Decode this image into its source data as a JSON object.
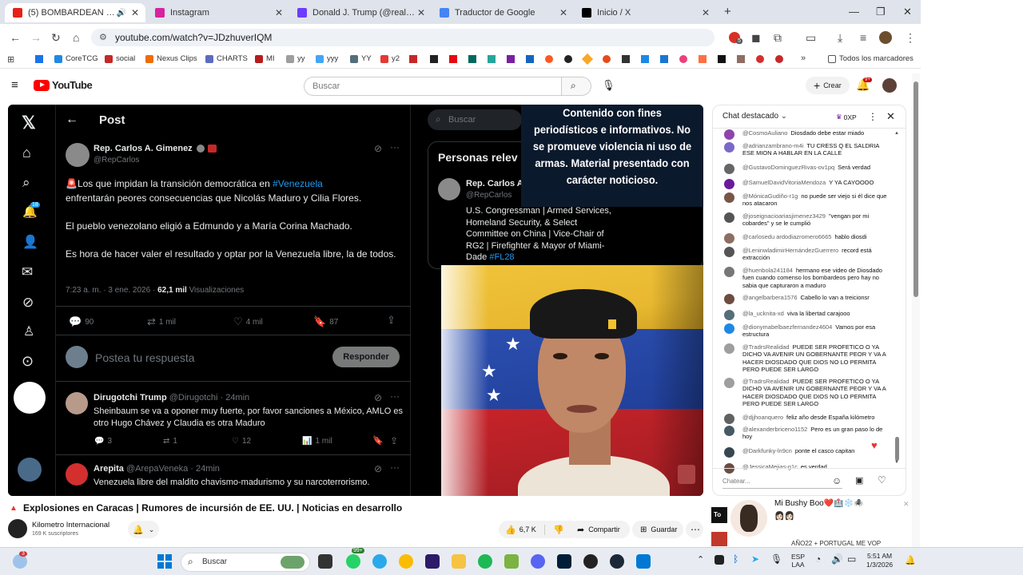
{
  "browser": {
    "tabs": [
      {
        "label": "(5) BOMBARDEAN CARACA",
        "color": "#e62117",
        "active": true
      },
      {
        "label": "Instagram",
        "color": "#d6249f",
        "active": false
      },
      {
        "label": "Donald J. Trump (@realDonald",
        "color": "#6e3bff",
        "active": false
      },
      {
        "label": "Traductor de Google",
        "color": "#4285f4",
        "active": false
      },
      {
        "label": "Inicio / X",
        "color": "#000000",
        "active": false
      }
    ],
    "url": "youtube.com/watch?v=JDzhuverIQM",
    "bookmarks": [
      "CoreTCG",
      "social",
      "Nexus Clips",
      "CHARTS",
      "MI",
      "yy",
      "yyy",
      "YY",
      "y2"
    ],
    "all_bookmarks": "Todos los marcadores",
    "notif_badge": "5"
  },
  "youtube": {
    "logo": "YouTube",
    "search_placeholder": "Buscar",
    "create": "Crear",
    "notif_count": "9+"
  },
  "video": {
    "x_header": "Post",
    "x_search": "Buscar",
    "x_notif_badge": "18",
    "author": "Rep. Carlos A. Gimenez",
    "handle": "@RepCarlos",
    "tweet_line1_pre": "🚨Los que impidan la transición democrática en ",
    "tweet_hashtag": "#Venezuela",
    "tweet_line2": "enfrentarán peores consecuencias que Nicolás Maduro y Cilia Flores.",
    "tweet_p2": "El pueblo venezolano eligió a Edmundo y a María Corina Machado.",
    "tweet_p3": "Es hora de hacer valer el resultado y optar por la Venezuela libre, la de todos.",
    "tweet_time": "7:23 a. m. · 3 ene. 2026 · ",
    "tweet_views": "62,1 mil",
    "tweet_views_label": "Visualizaciones",
    "stats": {
      "replies": "90",
      "reposts": "1 mil",
      "likes": "4 mil",
      "bookmarks": "87"
    },
    "reply_placeholder": "Postea tu respuesta",
    "reply_button": "Responder",
    "reply1_author": "Dirugotchi Trump",
    "reply1_handle": "@Dirugotchi · 24min",
    "reply1_text": "Sheinbaum se va a oponer muy fuerte, por favor sanciones a México, AMLO es otro Hugo Chávez y Claudia es otra Maduro",
    "reply1_stats": {
      "replies": "3",
      "reposts": "1",
      "likes": "12",
      "views": "1 mil"
    },
    "reply2_author": "Arepita",
    "reply2_handle": "@ArepaVeneka · 24min",
    "reply2_text": "Venezuela libre del maldito chavismo-madurismo y su narcoterrorismo.",
    "people_header": "Personas relev",
    "side_author": "Rep. Carlos A",
    "side_handle": "@RepCarlos",
    "side_bio": "U.S. Congressman | Armed Services, Homeland Security, & Select Committee on China | Vice-Chair of RG2 | Firefighter & Mayor of Miami-Dade",
    "side_tag": "#FL28",
    "disclaimer": "Contenido con fines periodísticos e informativos. No se promueve violencia ni uso de armas. Material presentado con carácter noticioso."
  },
  "chat": {
    "title": "Chat destacado",
    "xp": "0XP",
    "input_placeholder": "Chatear...",
    "messages": [
      {
        "user": "@CosmoAuliano",
        "text": "Diosdado debe estar miado",
        "color": "#8e44ad"
      },
      {
        "user": "@adrianzambrano-m4i",
        "text": "TU CRESS Q EL SALDRIA ESE MION A HABLAR EN LA CALLE",
        "color": "#7b68c8"
      },
      {
        "user": "@GustavoDominguezRivas-ov1pq",
        "text": "Será verdad",
        "color": "#666666"
      },
      {
        "user": "@SamuelDavidVitoriaMendoza",
        "text": "Y YA CAYOOOO",
        "color": "#6a1b9a"
      },
      {
        "user": "@MónicaGudiño-r1g",
        "text": "no puede ser viejo si él dice que nos atacaron",
        "color": "#795548"
      },
      {
        "user": "@joseignacioariasjimenez3429",
        "text": "\"vengan por mi cobardes\" y se le cumplió",
        "color": "#555555"
      },
      {
        "user": "@carlosedu ardodiazromero6665",
        "text": "hablo diosdi",
        "color": "#8d6e63"
      },
      {
        "user": "@LeninwladimirHernándezGuerrero",
        "text": "record está extracción",
        "color": "#555555"
      },
      {
        "user": "@huenbola241184",
        "text": "hermano ese video de Diosdado fuen cuando comenso los bombardeos pero hay no sabia que capturaron a maduro",
        "color": "#777777"
      },
      {
        "user": "@angelbarbera1576",
        "text": "Cabello lo van a treicionsr",
        "color": "#6d4c41"
      },
      {
        "user": "@la_ucknita-xd",
        "text": "viva la libertad carajooo",
        "color": "#546e7a"
      },
      {
        "user": "@dionymabelbaezfernandez4604",
        "text": "Vamos por esa estructura",
        "color": "#1e88e5"
      },
      {
        "user": "@TradrsRealidad",
        "text": "PUEDE SER PROFETICO O YA DICHO VA AVENIR UN GOBERNANTE PEOR Y VA A HACER DIOSDADO QUE DIOS NO LO PERMITA PERO PUEDE SER LARGO",
        "color": "#9e9e9e"
      },
      {
        "user": "@TradrsRealidad",
        "text": "PUEDE SER PROFETICO O YA DICHO VA AVENIR UN GOBERNANTE PEOR Y VA A HACER DIOSDADO QUE DIOS NO LO PERMITA PERO PUEDE SER LARGO",
        "color": "#9e9e9e"
      },
      {
        "user": "@djjhoanquero",
        "text": "feliz año desde España kilómetro",
        "color": "#616161"
      },
      {
        "user": "@alexanderbriceno1152",
        "text": "Pero es un gran paso lo de hoy",
        "color": "#455a64"
      },
      {
        "user": "@Darkfunky-ln9cn",
        "text": "ponte el casco capitan",
        "color": "#37474f"
      },
      {
        "user": "@JessicaMejias-g1c",
        "text": "es verdad",
        "color": "#6d4c41"
      }
    ]
  },
  "below": {
    "title": "Explosiones en Caracas | Rumores de incursión de EE. UU. | Noticias en desarrollo",
    "channel": "Kilometro Internacional",
    "subs": "169 K suscriptores",
    "likes": "6,7 K",
    "share": "Compartir",
    "save": "Guardar",
    "suggestion_name": "Mi Bushy Boo❤️🏥❄️🕷️",
    "suggestion_emoji": "👩🏻👩🏻",
    "suggestion2": "AÑO22 + PORTUGAL ME VOP"
  },
  "taskbar": {
    "search": "Buscar",
    "lang": "ESP",
    "lang2": "LAA",
    "time": "5:51 AM",
    "date": "1/3/2026",
    "badge1": "3",
    "badge2": "99+"
  }
}
